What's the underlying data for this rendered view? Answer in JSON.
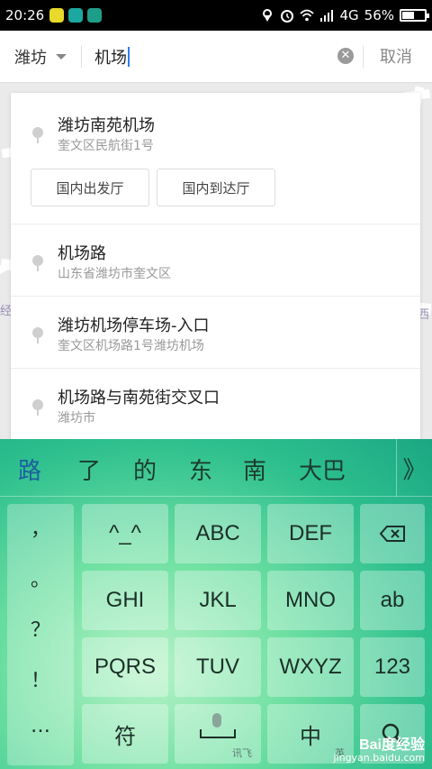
{
  "status_bar": {
    "time": "20:26",
    "network": "4G",
    "battery": "56%",
    "battery_level": 0.56
  },
  "search": {
    "city": "潍坊",
    "query": "机场",
    "cancel_label": "取消",
    "clear_icon": "clear-icon"
  },
  "map": {
    "label_left": "经",
    "label_right": "西"
  },
  "suggestions": [
    {
      "title": "潍坊南苑机场",
      "address": "奎文区民航街1号",
      "chips": [
        "国内出发厅",
        "国内到达厅"
      ]
    },
    {
      "title": "机场路",
      "address": "山东省潍坊市奎文区"
    },
    {
      "title": "潍坊机场停车场-入口",
      "address": "奎文区机场路1号潍坊机场"
    },
    {
      "title": "机场路与南苑街交叉口",
      "address": "潍坊市"
    }
  ],
  "keyboard": {
    "candidates": [
      "路",
      "了",
      "的",
      "东",
      "南",
      "大巴"
    ],
    "more_label": "》",
    "punctuation": [
      "，",
      "。",
      "？",
      "！",
      "…"
    ],
    "keys": {
      "emoticon": "^_^",
      "abc": "ABC",
      "def": "DEF",
      "ghi": "GHI",
      "jkl": "JKL",
      "mno": "MNO",
      "ab": "ab",
      "pqrs": "PQRS",
      "tuv": "TUV",
      "wxyz": "WXYZ",
      "num": "123",
      "symbol": "符",
      "space_hint": "讯飞",
      "lang": "中",
      "lang_alt": "英"
    },
    "watermark_main": "Bai度经验",
    "watermark_sub": "jingyan.baidu.com"
  },
  "colors": {
    "caret": "#2c7cf6",
    "candidate_highlight": "#1e5fa0",
    "keyboard_theme": "#2ec08e"
  }
}
